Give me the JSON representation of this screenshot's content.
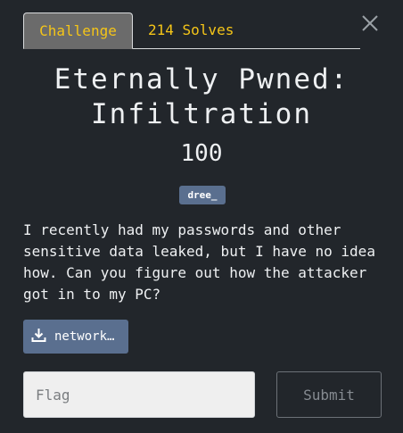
{
  "tabs": {
    "challenge_label": "Challenge",
    "solves_label": "214 Solves"
  },
  "challenge": {
    "title": "Eternally Pwned: Infiltration",
    "points": "100",
    "author": "dree_",
    "description": "I recently had my passwords and other sensitive data leaked, but I have no idea how. Can you figure out how the attacker got in to my PC?"
  },
  "file": {
    "label": "network…",
    "icon": "download-icon"
  },
  "form": {
    "flag_placeholder": "Flag",
    "submit_label": "Submit"
  },
  "colors": {
    "background": "#22262b",
    "tab_text": "#f5c518",
    "active_tab_bg": "#6b6b6b",
    "badge_bg": "#5a6f8f",
    "text": "#eef0f2"
  }
}
